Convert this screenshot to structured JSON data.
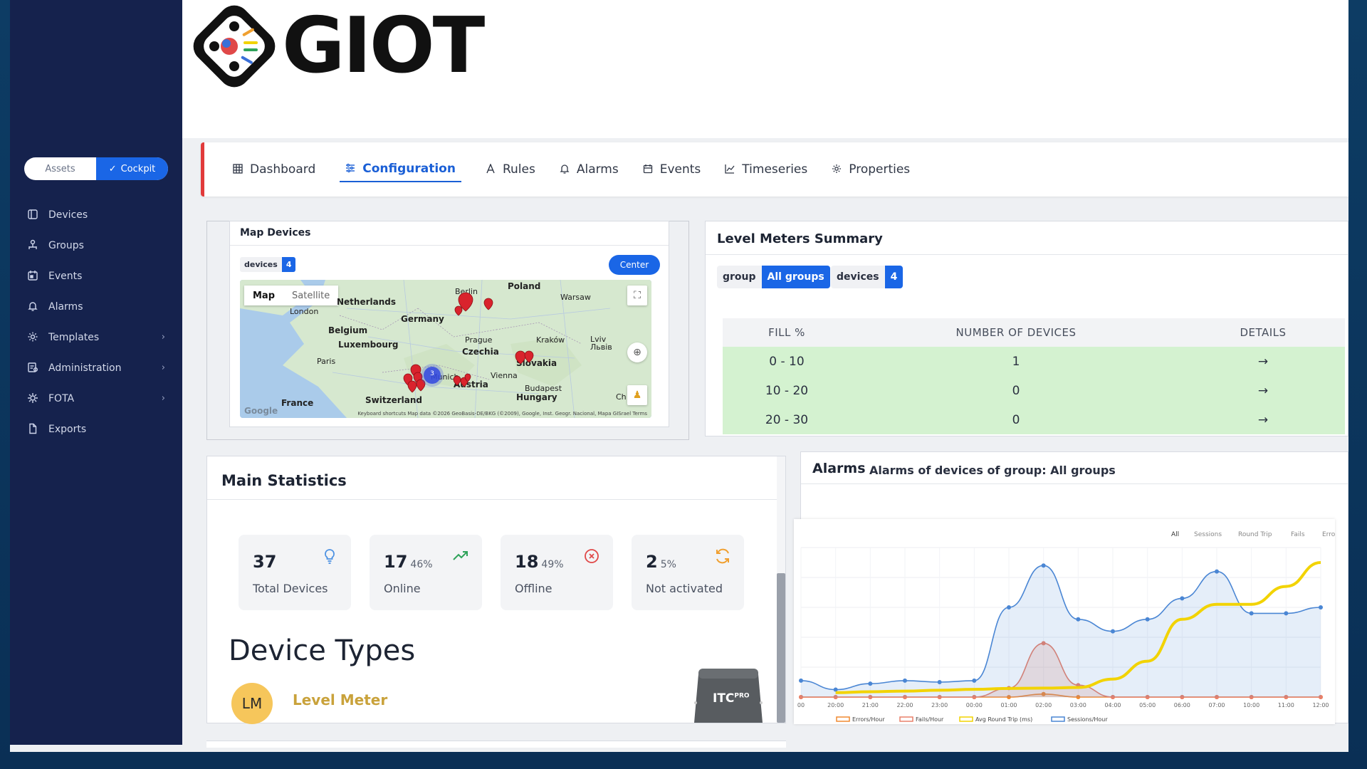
{
  "brand": {
    "name": "GIOT"
  },
  "sidebar": {
    "toggle": {
      "assets": "Assets",
      "cockpit": "Cockpit"
    },
    "items": [
      {
        "label": "Devices",
        "icon": "devices-icon"
      },
      {
        "label": "Groups",
        "icon": "groups-icon"
      },
      {
        "label": "Events",
        "icon": "events-icon"
      },
      {
        "label": "Alarms",
        "icon": "bell-icon"
      },
      {
        "label": "Templates",
        "icon": "gear-icon",
        "chevron": "›"
      },
      {
        "label": "Administration",
        "icon": "admin-icon",
        "chevron": "›"
      },
      {
        "label": "FOTA",
        "icon": "cog-icon",
        "chevron": "›"
      },
      {
        "label": "Exports",
        "icon": "file-icon"
      }
    ]
  },
  "tabs": [
    {
      "label": "Dashboard",
      "active": false
    },
    {
      "label": "Configuration",
      "active": true
    },
    {
      "label": "Rules",
      "active": false
    },
    {
      "label": "Alarms",
      "active": false
    },
    {
      "label": "Events",
      "active": false
    },
    {
      "label": "Timeseries",
      "active": false
    },
    {
      "label": "Properties",
      "active": false
    }
  ],
  "map_panel": {
    "title": "Map Devices",
    "devices_label": "devices",
    "devices_count": "4",
    "center_button": "Center",
    "map_toggle": {
      "map": "Map",
      "satellite": "Satellite"
    },
    "cluster_count": "3",
    "labels": {
      "poland": "Poland",
      "berlin": "Berlin",
      "warsaw": "Warsaw",
      "netherlands": "Netherlands",
      "london": "London",
      "germany": "Germany",
      "belgium": "Belgium",
      "luxembourg": "Luxembourg",
      "prague": "Prague",
      "czechia": "Czechia",
      "krakow": "Kraków",
      "lviv": "Lviv\nЛьвів",
      "paris": "Paris",
      "slovakia": "Slovakia",
      "vienna": "Vienna",
      "munich": "Munich",
      "austria": "Austria",
      "budapest": "Budapest",
      "hungary": "Hungary",
      "switzerland": "Switzerland",
      "france": "France",
      "ch": "Ch"
    },
    "google": "Google",
    "footer": "Keyboard shortcuts    Map data ©2026 GeoBasis-DE/BKG (©2009), Google, Inst. Geogr. Nacional, Mapa GISrael    Terms"
  },
  "level_meters": {
    "title": "Level Meters Summary",
    "group_label": "group",
    "group_value": "All groups",
    "devices_label": "devices",
    "devices_value": "4",
    "headers": [
      "FILL %",
      "NUMBER OF DEVICES",
      "DETAILS"
    ],
    "rows": [
      {
        "fill": "0 - 10",
        "count": "1",
        "details": "→"
      },
      {
        "fill": "10 - 20",
        "count": "0",
        "details": "→"
      },
      {
        "fill": "20 - 30",
        "count": "0",
        "details": "→"
      }
    ]
  },
  "main_stats": {
    "title": "Main Statistics",
    "cards": [
      {
        "value": "37",
        "pct": "",
        "label": "Total Devices",
        "icon": "lightbulb-icon",
        "color": "#4a90e2"
      },
      {
        "value": "17",
        "pct": "46%",
        "label": "Online",
        "icon": "trending-up-icon",
        "color": "#2fa35a"
      },
      {
        "value": "18",
        "pct": "49%",
        "label": "Offline",
        "icon": "x-circle-icon",
        "color": "#e04848"
      },
      {
        "value": "2",
        "pct": "5%",
        "label": "Not activated",
        "icon": "refresh-icon",
        "color": "#f0a030"
      }
    ],
    "device_types_title": "Device Types",
    "device_type": {
      "initials": "LM",
      "name": "Level Meter"
    },
    "device_image_label": "ITC",
    "device_image_sup": "PRO"
  },
  "alarms": {
    "title": "Alarms",
    "subtitle": "Alarms of devices of group: All groups"
  },
  "chart_data": {
    "type": "line",
    "filters": [
      "All",
      "Sessions",
      "Round Trip",
      "Fails",
      "Errors"
    ],
    "x": [
      "00",
      "20:00",
      "21:00",
      "22:00",
      "23:00",
      "00:00",
      "01:00",
      "02:00",
      "03:00",
      "04:00",
      "05:00",
      "06:00",
      "07:00",
      "10:00",
      "11:00",
      "12:00"
    ],
    "series": [
      {
        "name": "Sessions/Hour",
        "color": "#4a86d4",
        "values": [
          5.5,
          2.5,
          4.5,
          5.5,
          5.0,
          5.5,
          30,
          44,
          26,
          22,
          26,
          33,
          42,
          28,
          28,
          30
        ]
      },
      {
        "name": "Avg Round Trip (ms)",
        "color": "#f2d300",
        "values": [
          null,
          1.5,
          1.8,
          2.0,
          2.3,
          2.6,
          2.9,
          3.0,
          3.2,
          6.0,
          12,
          26,
          31,
          31,
          37,
          45
        ]
      },
      {
        "name": "Fails/Hour",
        "color": "#e8806a",
        "values": [
          0,
          0,
          0,
          0,
          0,
          0,
          3,
          18,
          4,
          0,
          0,
          0,
          0,
          0,
          0,
          0
        ]
      },
      {
        "name": "Errors/Hour",
        "color": "#f08a30",
        "values": [
          0,
          0,
          0,
          0,
          0,
          0,
          0,
          1,
          0,
          0,
          0,
          0,
          0,
          0,
          0,
          0
        ]
      }
    ],
    "legend": [
      "Errors/Hour",
      "Fails/Hour",
      "Avg Round Trip (ms)",
      "Sessions/Hour"
    ],
    "legend_colors": [
      "#f08a30",
      "#e8806a",
      "#f2d300",
      "#4a86d4"
    ],
    "ylim": [
      0,
      50
    ]
  }
}
